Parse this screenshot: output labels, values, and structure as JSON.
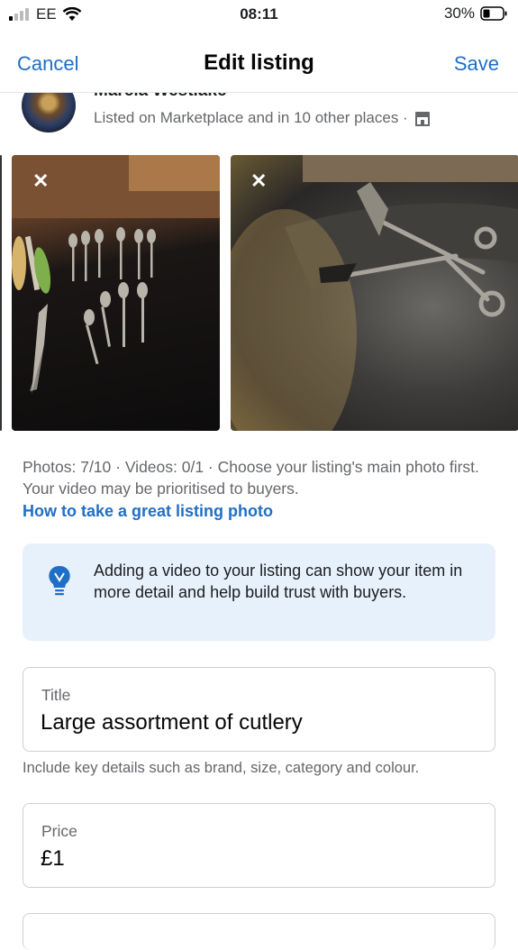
{
  "status_bar": {
    "carrier": "EE",
    "time": "08:11",
    "battery": "30%"
  },
  "nav": {
    "cancel": "Cancel",
    "title": "Edit listing",
    "save": "Save"
  },
  "seller": {
    "name": "Marcia Westlake",
    "listed": "Listed on Marketplace and in 10 other places ·"
  },
  "photos": {
    "count_text": "Photos: 7/10 · Videos: 0/1 · Choose your listing's main photo first. Your video may be prioritised to buyers.",
    "howto_link": "How to take a great listing photo",
    "remove_label": "✕"
  },
  "tip": {
    "text": "Adding a video to your listing can show your item in more detail and help build trust with buyers."
  },
  "fields": {
    "title_label": "Title",
    "title_value": "Large assortment of cutlery",
    "title_helper": "Include key details such as brand, size, category and colour.",
    "price_label": "Price",
    "price_value": "£1"
  },
  "colors": {
    "link": "#1f6fc5",
    "tip_background": "#e7f1fc"
  }
}
